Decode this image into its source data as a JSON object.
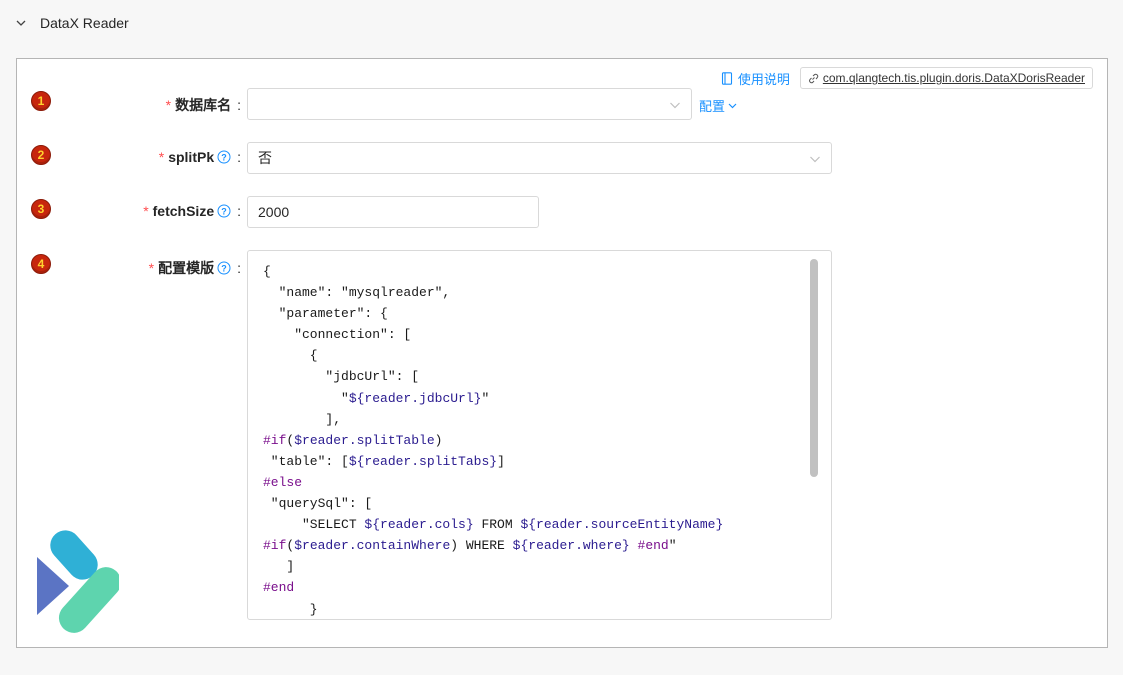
{
  "section": {
    "title": "DataX Reader",
    "chevron_icon": "chevron-down-icon"
  },
  "topbar": {
    "doc_link": "使用说明",
    "plugin_class": "com.qlangtech.tis.plugin.doris.DataXDorisReader"
  },
  "fields": [
    {
      "index": "1",
      "label": "数据库名",
      "required": true,
      "help": false,
      "type": "select",
      "value": "",
      "extra_link": "配置"
    },
    {
      "index": "2",
      "label": "splitPk",
      "required": true,
      "help": true,
      "type": "select",
      "value": "否"
    },
    {
      "index": "3",
      "label": "fetchSize",
      "required": true,
      "help": true,
      "type": "input",
      "value": "2000"
    },
    {
      "index": "4",
      "label": "配置模版",
      "required": true,
      "help": true,
      "type": "code"
    }
  ],
  "template_lines": [
    [
      [
        "p",
        "{"
      ]
    ],
    [
      [
        "p",
        "  \"name\": \"mysqlreader\","
      ]
    ],
    [
      [
        "p",
        "  \"parameter\": {"
      ]
    ],
    [
      [
        "p",
        "    \"connection\": ["
      ]
    ],
    [
      [
        "p",
        "      {"
      ]
    ],
    [
      [
        "p",
        "        \"jdbcUrl\": ["
      ]
    ],
    [
      [
        "p",
        "          \""
      ],
      [
        "v",
        "${reader.jdbcUrl}"
      ],
      [
        "p",
        "\""
      ]
    ],
    [
      [
        "p",
        "        ],"
      ]
    ],
    [
      [
        "k",
        "#if"
      ],
      [
        "p",
        "("
      ],
      [
        "v",
        "$reader.splitTable"
      ],
      [
        "p",
        ")"
      ]
    ],
    [
      [
        "p",
        " \"table\": ["
      ],
      [
        "v",
        "${reader.splitTabs}"
      ],
      [
        "p",
        "]"
      ]
    ],
    [
      [
        "k",
        "#else"
      ]
    ],
    [
      [
        "p",
        " \"querySql\": ["
      ]
    ],
    [
      [
        "p",
        "     \"SELECT "
      ],
      [
        "v",
        "${reader.cols}"
      ],
      [
        "p",
        " FROM "
      ],
      [
        "v",
        "${reader.sourceEntityName}"
      ]
    ],
    [
      [
        "k",
        "#if"
      ],
      [
        "p",
        "("
      ],
      [
        "v",
        "$reader.containWhere"
      ],
      [
        "p",
        ") WHERE "
      ],
      [
        "v",
        "${reader.where}"
      ],
      [
        "p",
        " "
      ],
      [
        "k",
        "#end"
      ],
      [
        "p",
        "\""
      ]
    ],
    [
      [
        "p",
        "   ]"
      ]
    ],
    [
      [
        "k",
        "#end"
      ]
    ],
    [
      [
        "p",
        "      }"
      ]
    ]
  ],
  "colors": {
    "accent": "#1890ff",
    "required": "#ff4d4f",
    "badge": "#c7260d",
    "keyword": "#7a0f8c",
    "variable": "#2a1b8f"
  }
}
